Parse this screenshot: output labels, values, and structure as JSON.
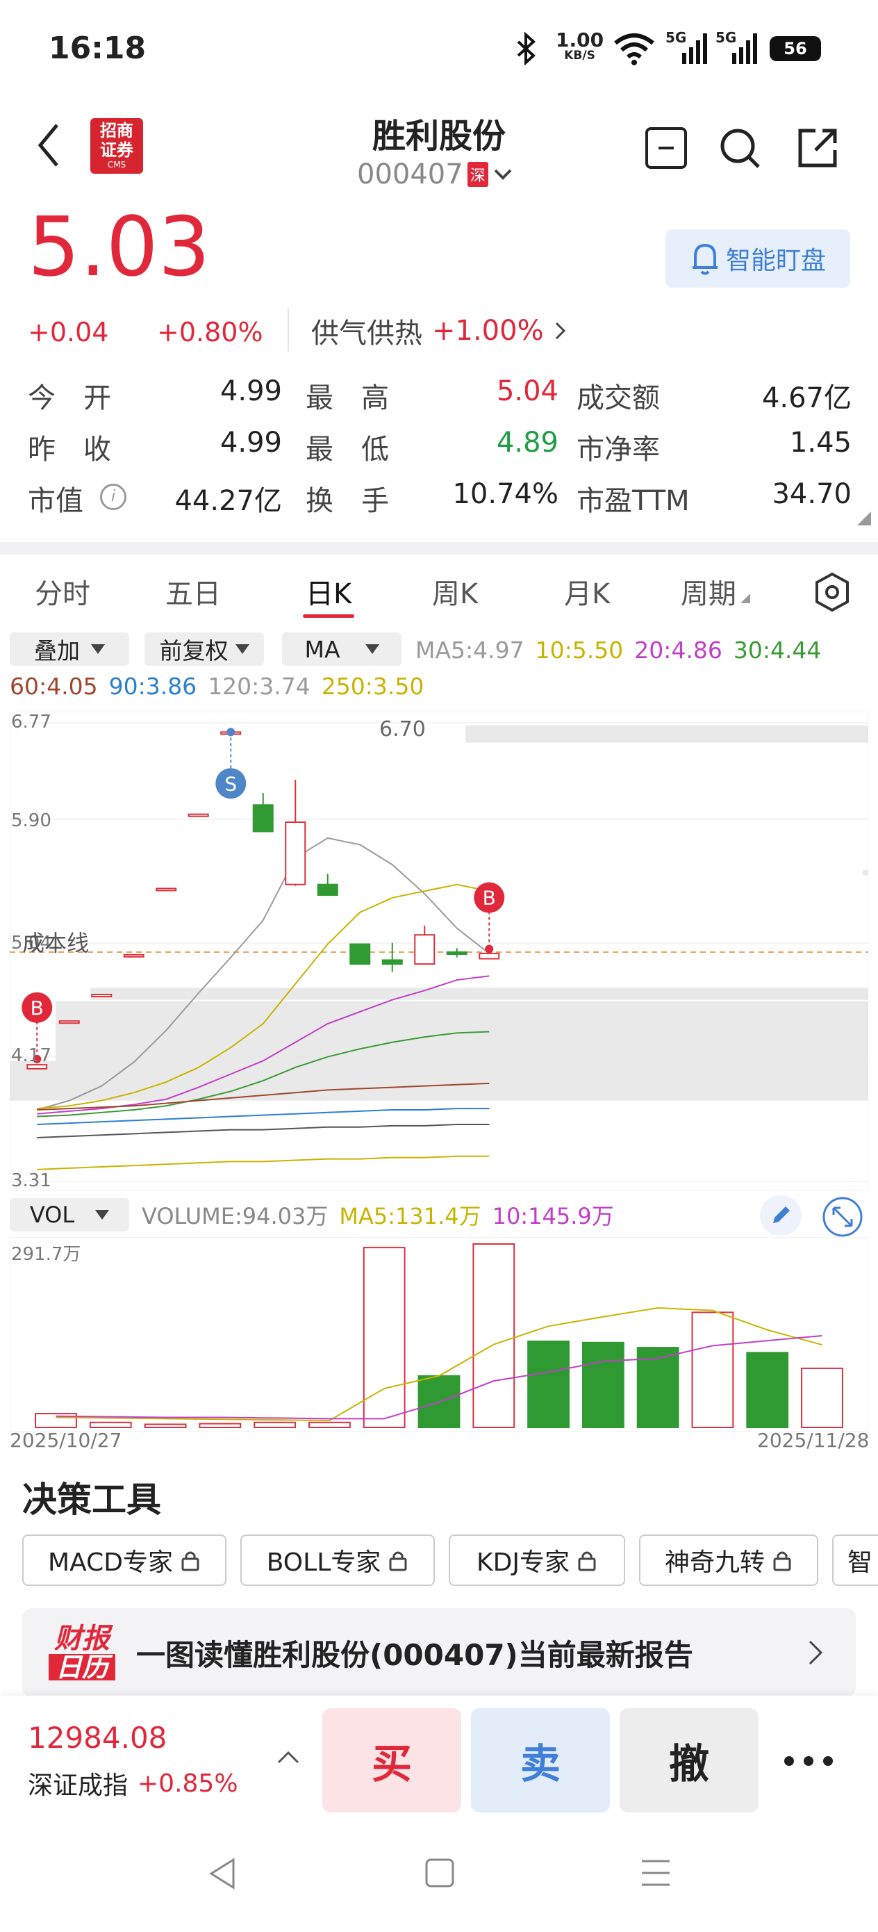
{
  "status_bar": {
    "time": "16:18",
    "speed_value": "1.00",
    "speed_unit": "KB/S",
    "net1": "5G",
    "net2": "5G",
    "battery": "56"
  },
  "header": {
    "logo_line1": "招商",
    "logo_line2": "证券",
    "logo_sub": "CMS",
    "title": "胜利股份",
    "code": "000407",
    "market": "深"
  },
  "quote": {
    "price": "5.03",
    "change": "+0.04",
    "change_pct": "+0.80%",
    "watch_label": "智能盯盘",
    "sector_name": "供气供热",
    "sector_change": "+1.00%",
    "stats": [
      {
        "label": "今　开",
        "value": "4.99",
        "color": "#222"
      },
      {
        "label": "最　高",
        "value": "5.04",
        "color": "#e0283a"
      },
      {
        "label": "成交额",
        "value": "4.67亿",
        "color": "#222"
      },
      {
        "label": "昨　收",
        "value": "4.99",
        "color": "#222"
      },
      {
        "label": "最　低",
        "value": "4.89",
        "color": "#1f9e44"
      },
      {
        "label": "市净率",
        "value": "1.45",
        "color": "#222"
      },
      {
        "label": "市值",
        "value": "44.27亿",
        "color": "#222"
      },
      {
        "label": "换　手",
        "value": "10.74%",
        "color": "#222"
      },
      {
        "label": "市盈TTM",
        "value": "34.70",
        "color": "#222"
      }
    ]
  },
  "tabs": [
    "分时",
    "五日",
    "日K",
    "周K",
    "月K",
    "周期"
  ],
  "active_tab": 2,
  "controls": {
    "overlay": "叠加",
    "adjust": "前复权",
    "indicator": "MA",
    "vol": "VOL"
  },
  "ma_line1": [
    {
      "text": "MA5:4.97",
      "color": "#9a9a9a"
    },
    {
      "text": "10:5.50",
      "color": "#c8b400"
    },
    {
      "text": "20:4.86",
      "color": "#c03fc8"
    },
    {
      "text": "30:4.44",
      "color": "#3a9a34"
    }
  ],
  "ma_line2": [
    {
      "text": "60:4.05",
      "color": "#a0462e"
    },
    {
      "text": "90:3.86",
      "color": "#2b7fd1"
    },
    {
      "text": "120:3.74",
      "color": "#9a9a9a"
    },
    {
      "text": "250:3.50",
      "color": "#c8b400"
    }
  ],
  "chart_data": {
    "type": "candlestick",
    "ylim": [
      3.31,
      6.77
    ],
    "y_ticks": [
      "6.77",
      "5.90",
      "5.04",
      "4.17",
      "3.31"
    ],
    "max_label": "6.70",
    "cost_line_label": "成本线",
    "cost_line": 5.04,
    "markers": [
      {
        "label": "S",
        "candle": 6
      },
      {
        "label": "B",
        "candle": 0
      },
      {
        "label": "B",
        "candle": 14
      }
    ],
    "candles": [
      {
        "o": 4.16,
        "c": 4.19,
        "h": 4.19,
        "l": 4.16
      },
      {
        "o": 4.52,
        "c": 4.52,
        "h": 4.52,
        "l": 4.52
      },
      {
        "o": 4.72,
        "c": 4.72,
        "h": 4.72,
        "l": 4.72
      },
      {
        "o": 5.02,
        "c": 5.02,
        "h": 5.02,
        "l": 5.02
      },
      {
        "o": 5.52,
        "c": 5.52,
        "h": 5.52,
        "l": 5.52
      },
      {
        "o": 6.08,
        "c": 6.08,
        "h": 6.08,
        "l": 6.08
      },
      {
        "o": 6.7,
        "c": 6.7,
        "h": 6.7,
        "l": 6.7
      },
      {
        "o": 6.15,
        "c": 5.95,
        "h": 6.24,
        "l": 5.95
      },
      {
        "o": 5.55,
        "c": 6.02,
        "h": 6.34,
        "l": 5.54
      },
      {
        "o": 5.55,
        "c": 5.47,
        "h": 5.63,
        "l": 5.47
      },
      {
        "o": 5.1,
        "c": 4.95,
        "h": 5.1,
        "l": 4.95
      },
      {
        "o": 4.98,
        "c": 4.95,
        "h": 5.11,
        "l": 4.89
      },
      {
        "o": 4.95,
        "c": 5.17,
        "h": 5.24,
        "l": 4.95
      },
      {
        "o": 5.04,
        "c": 5.03,
        "h": 5.07,
        "l": 5.0
      },
      {
        "o": 4.99,
        "c": 5.03,
        "h": 5.08,
        "l": 4.99
      }
    ],
    "ma_series": [
      {
        "name": "MA5",
        "color": "#9a9a9a",
        "values": [
          3.85,
          3.92,
          4.03,
          4.21,
          4.45,
          4.73,
          5.0,
          5.28,
          5.75,
          5.9,
          5.85,
          5.7,
          5.48,
          5.22,
          5.03
        ]
      },
      {
        "name": "10",
        "color": "#c8b400",
        "values": [
          3.86,
          3.88,
          3.92,
          3.98,
          4.06,
          4.17,
          4.32,
          4.5,
          4.8,
          5.1,
          5.34,
          5.45,
          5.5,
          5.55,
          5.5
        ]
      },
      {
        "name": "20",
        "color": "#c03fc8",
        "values": [
          3.82,
          3.84,
          3.86,
          3.89,
          3.93,
          4.02,
          4.12,
          4.22,
          4.36,
          4.5,
          4.59,
          4.68,
          4.75,
          4.83,
          4.86
        ]
      },
      {
        "name": "30",
        "color": "#3a9a34",
        "values": [
          3.8,
          3.81,
          3.83,
          3.85,
          3.88,
          3.93,
          3.99,
          4.07,
          4.17,
          4.25,
          4.31,
          4.36,
          4.4,
          4.43,
          4.44
        ]
      },
      {
        "name": "60",
        "color": "#a0462e",
        "values": [
          3.85,
          3.86,
          3.87,
          3.88,
          3.9,
          3.92,
          3.94,
          3.96,
          3.98,
          4.0,
          4.01,
          4.02,
          4.03,
          4.04,
          4.05
        ]
      },
      {
        "name": "90",
        "color": "#2b7fd1",
        "values": [
          3.74,
          3.75,
          3.76,
          3.77,
          3.78,
          3.79,
          3.8,
          3.81,
          3.82,
          3.83,
          3.84,
          3.85,
          3.85,
          3.86,
          3.86
        ]
      },
      {
        "name": "120",
        "color": "#555555",
        "values": [
          3.64,
          3.65,
          3.66,
          3.67,
          3.68,
          3.69,
          3.7,
          3.7,
          3.71,
          3.72,
          3.72,
          3.73,
          3.73,
          3.74,
          3.74
        ]
      },
      {
        "name": "250",
        "color": "#c8b400",
        "values": [
          3.4,
          3.41,
          3.42,
          3.43,
          3.44,
          3.45,
          3.46,
          3.46,
          3.47,
          3.48,
          3.48,
          3.49,
          3.49,
          3.5,
          3.5
        ]
      }
    ],
    "volume": {
      "header": "VOLUME:94.03万",
      "ma5_label": "MA5:131.4万",
      "ma10_label": "10:145.9万",
      "y_max_label": "291.7万",
      "ymax": 291.7,
      "values": [
        22,
        8,
        5,
        6,
        8,
        8,
        286,
        82,
        291.7,
        137,
        135,
        127,
        183,
        119,
        94.03
      ],
      "colors": [
        "r",
        "r",
        "r",
        "r",
        "r",
        "r",
        "r",
        "g",
        "r",
        "g",
        "g",
        "g",
        "r",
        "g",
        "r"
      ],
      "ma5": [
        16,
        15,
        14,
        13,
        12,
        11,
        62,
        82,
        132,
        161,
        176,
        190,
        186,
        155,
        131.4
      ],
      "ma10": [
        18,
        17,
        16,
        16,
        15,
        14,
        14,
        40,
        74,
        88,
        105,
        110,
        130,
        138,
        145.9
      ]
    },
    "x_start": "2025/10/27",
    "x_end": "2025/11/28"
  },
  "tools": {
    "title": "决策工具",
    "items": [
      "MACD专家",
      "BOLL专家",
      "KDJ专家",
      "神奇九转",
      "智"
    ]
  },
  "report": {
    "logo_top": "财报",
    "logo_bottom": "日历",
    "text": "一图读懂胜利股份(000407)当前最新报告"
  },
  "bottom": {
    "index_value": "12984.08",
    "index_name": "深证成指",
    "index_change": "+0.85%",
    "buy": "买",
    "sell": "卖",
    "cancel": "撤"
  }
}
